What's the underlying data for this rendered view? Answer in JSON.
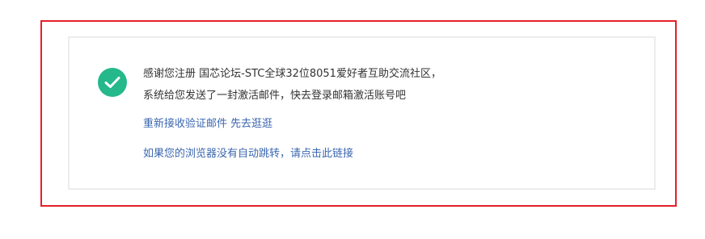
{
  "message": {
    "line1": "感谢您注册 国芯论坛-STC全球32位8051爱好者互助交流社区，",
    "line2": "系统给您发送了一封激活邮件，快去登录邮箱激活账号吧"
  },
  "links": {
    "resend": "重新接收验证邮件",
    "browse": "先去逛逛",
    "redirect": "如果您的浏览器没有自动跳转，请点击此链接"
  },
  "icons": {
    "success": "check-circle-icon"
  },
  "colors": {
    "frame_border": "#e5202a",
    "success_green": "#25b88a",
    "link_blue": "#3b67b0",
    "text": "#333333"
  }
}
